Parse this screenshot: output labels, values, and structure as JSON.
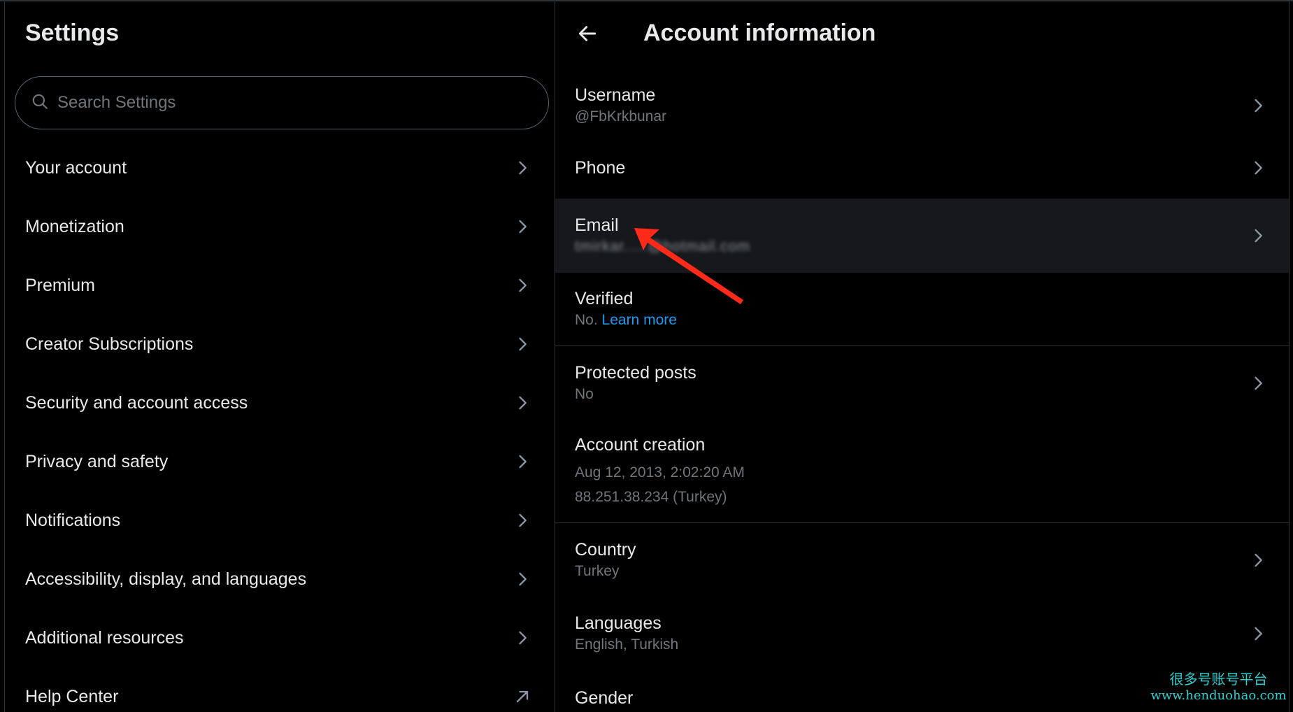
{
  "left_panel": {
    "title": "Settings",
    "search": {
      "placeholder": "Search Settings",
      "icon": "search-icon"
    },
    "menu": [
      {
        "label": "Your account",
        "icon": "chevron-right-icon"
      },
      {
        "label": "Monetization",
        "icon": "chevron-right-icon"
      },
      {
        "label": "Premium",
        "icon": "chevron-right-icon"
      },
      {
        "label": "Creator Subscriptions",
        "icon": "chevron-right-icon"
      },
      {
        "label": "Security and account access",
        "icon": "chevron-right-icon"
      },
      {
        "label": "Privacy and safety",
        "icon": "chevron-right-icon"
      },
      {
        "label": "Notifications",
        "icon": "chevron-right-icon"
      },
      {
        "label": "Accessibility, display, and languages",
        "icon": "chevron-right-icon"
      },
      {
        "label": "Additional resources",
        "icon": "chevron-right-icon"
      },
      {
        "label": "Help Center",
        "icon": "external-link-icon"
      }
    ]
  },
  "right_panel": {
    "title": "Account information",
    "back_icon": "arrow-left-icon",
    "rows": {
      "username": {
        "label": "Username",
        "value": "@FbKrkbunar"
      },
      "phone": {
        "label": "Phone"
      },
      "email": {
        "label": "Email",
        "value": "tmirkar.....@hotmail.com"
      },
      "verified": {
        "label": "Verified",
        "value_prefix": "No.",
        "link": "Learn more"
      },
      "protected": {
        "label": "Protected posts",
        "value": "No"
      },
      "creation": {
        "label": "Account creation",
        "date": "Aug 12, 2013, 2:02:20 AM",
        "ip": "88.251.38.234 (Turkey)"
      },
      "country": {
        "label": "Country",
        "value": "Turkey"
      },
      "languages": {
        "label": "Languages",
        "value": "English, Turkish"
      },
      "gender": {
        "label": "Gender"
      }
    }
  },
  "watermark": {
    "line1": "很多号账号平台",
    "line2": "www.henduohao.com"
  },
  "colors": {
    "background": "#000000",
    "text": "#e7e9ea",
    "muted": "#71767b",
    "link": "#1d9bf0",
    "arrow": "#ff2a1a",
    "watermark": "#2bd0d0"
  }
}
